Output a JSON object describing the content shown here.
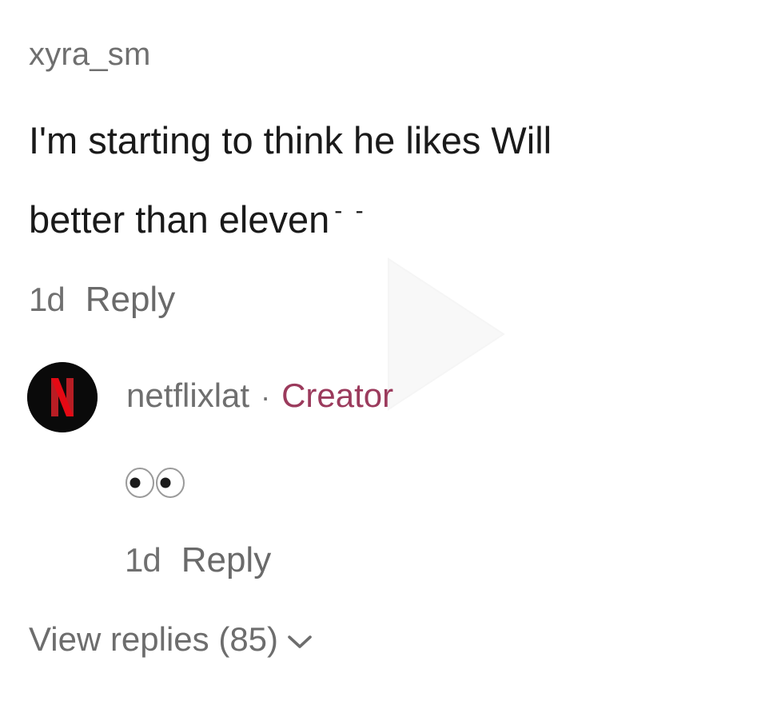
{
  "comment": {
    "username": "xyra_sm",
    "text_line1": "I'm starting to think he likes Will",
    "text_line2": "better than eleven",
    "text_suffix": "- -",
    "time": "1d",
    "reply_label": "Reply"
  },
  "reply": {
    "avatar_icon": "netflix-logo-icon",
    "avatar_letter": "N",
    "handle": "netflixlat",
    "separator": "·",
    "badge": "Creator",
    "emoji_icon": "eyes-emoji-icon",
    "time": "1d",
    "reply_label": "Reply"
  },
  "view_replies": {
    "label": "View replies (85)",
    "icon": "chevron-down-icon"
  },
  "colors": {
    "creator_badge": "#9b3a5c",
    "netflix_red": "#d81f26",
    "muted_text": "#6f6f6f",
    "body_text": "#1a1a1a"
  }
}
